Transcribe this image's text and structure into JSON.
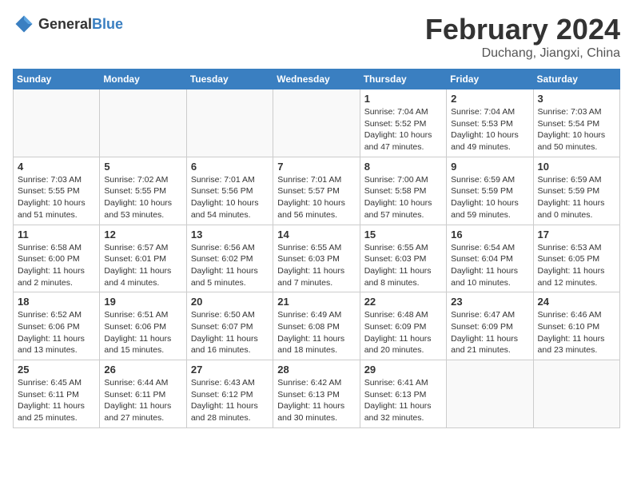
{
  "header": {
    "logo_general": "General",
    "logo_blue": "Blue",
    "month": "February 2024",
    "location": "Duchang, Jiangxi, China"
  },
  "weekdays": [
    "Sunday",
    "Monday",
    "Tuesday",
    "Wednesday",
    "Thursday",
    "Friday",
    "Saturday"
  ],
  "weeks": [
    [
      {
        "day": "",
        "info": ""
      },
      {
        "day": "",
        "info": ""
      },
      {
        "day": "",
        "info": ""
      },
      {
        "day": "",
        "info": ""
      },
      {
        "day": "1",
        "info": "Sunrise: 7:04 AM\nSunset: 5:52 PM\nDaylight: 10 hours\nand 47 minutes."
      },
      {
        "day": "2",
        "info": "Sunrise: 7:04 AM\nSunset: 5:53 PM\nDaylight: 10 hours\nand 49 minutes."
      },
      {
        "day": "3",
        "info": "Sunrise: 7:03 AM\nSunset: 5:54 PM\nDaylight: 10 hours\nand 50 minutes."
      }
    ],
    [
      {
        "day": "4",
        "info": "Sunrise: 7:03 AM\nSunset: 5:55 PM\nDaylight: 10 hours\nand 51 minutes."
      },
      {
        "day": "5",
        "info": "Sunrise: 7:02 AM\nSunset: 5:55 PM\nDaylight: 10 hours\nand 53 minutes."
      },
      {
        "day": "6",
        "info": "Sunrise: 7:01 AM\nSunset: 5:56 PM\nDaylight: 10 hours\nand 54 minutes."
      },
      {
        "day": "7",
        "info": "Sunrise: 7:01 AM\nSunset: 5:57 PM\nDaylight: 10 hours\nand 56 minutes."
      },
      {
        "day": "8",
        "info": "Sunrise: 7:00 AM\nSunset: 5:58 PM\nDaylight: 10 hours\nand 57 minutes."
      },
      {
        "day": "9",
        "info": "Sunrise: 6:59 AM\nSunset: 5:59 PM\nDaylight: 10 hours\nand 59 minutes."
      },
      {
        "day": "10",
        "info": "Sunrise: 6:59 AM\nSunset: 5:59 PM\nDaylight: 11 hours\nand 0 minutes."
      }
    ],
    [
      {
        "day": "11",
        "info": "Sunrise: 6:58 AM\nSunset: 6:00 PM\nDaylight: 11 hours\nand 2 minutes."
      },
      {
        "day": "12",
        "info": "Sunrise: 6:57 AM\nSunset: 6:01 PM\nDaylight: 11 hours\nand 4 minutes."
      },
      {
        "day": "13",
        "info": "Sunrise: 6:56 AM\nSunset: 6:02 PM\nDaylight: 11 hours\nand 5 minutes."
      },
      {
        "day": "14",
        "info": "Sunrise: 6:55 AM\nSunset: 6:03 PM\nDaylight: 11 hours\nand 7 minutes."
      },
      {
        "day": "15",
        "info": "Sunrise: 6:55 AM\nSunset: 6:03 PM\nDaylight: 11 hours\nand 8 minutes."
      },
      {
        "day": "16",
        "info": "Sunrise: 6:54 AM\nSunset: 6:04 PM\nDaylight: 11 hours\nand 10 minutes."
      },
      {
        "day": "17",
        "info": "Sunrise: 6:53 AM\nSunset: 6:05 PM\nDaylight: 11 hours\nand 12 minutes."
      }
    ],
    [
      {
        "day": "18",
        "info": "Sunrise: 6:52 AM\nSunset: 6:06 PM\nDaylight: 11 hours\nand 13 minutes."
      },
      {
        "day": "19",
        "info": "Sunrise: 6:51 AM\nSunset: 6:06 PM\nDaylight: 11 hours\nand 15 minutes."
      },
      {
        "day": "20",
        "info": "Sunrise: 6:50 AM\nSunset: 6:07 PM\nDaylight: 11 hours\nand 16 minutes."
      },
      {
        "day": "21",
        "info": "Sunrise: 6:49 AM\nSunset: 6:08 PM\nDaylight: 11 hours\nand 18 minutes."
      },
      {
        "day": "22",
        "info": "Sunrise: 6:48 AM\nSunset: 6:09 PM\nDaylight: 11 hours\nand 20 minutes."
      },
      {
        "day": "23",
        "info": "Sunrise: 6:47 AM\nSunset: 6:09 PM\nDaylight: 11 hours\nand 21 minutes."
      },
      {
        "day": "24",
        "info": "Sunrise: 6:46 AM\nSunset: 6:10 PM\nDaylight: 11 hours\nand 23 minutes."
      }
    ],
    [
      {
        "day": "25",
        "info": "Sunrise: 6:45 AM\nSunset: 6:11 PM\nDaylight: 11 hours\nand 25 minutes."
      },
      {
        "day": "26",
        "info": "Sunrise: 6:44 AM\nSunset: 6:11 PM\nDaylight: 11 hours\nand 27 minutes."
      },
      {
        "day": "27",
        "info": "Sunrise: 6:43 AM\nSunset: 6:12 PM\nDaylight: 11 hours\nand 28 minutes."
      },
      {
        "day": "28",
        "info": "Sunrise: 6:42 AM\nSunset: 6:13 PM\nDaylight: 11 hours\nand 30 minutes."
      },
      {
        "day": "29",
        "info": "Sunrise: 6:41 AM\nSunset: 6:13 PM\nDaylight: 11 hours\nand 32 minutes."
      },
      {
        "day": "",
        "info": ""
      },
      {
        "day": "",
        "info": ""
      }
    ]
  ]
}
